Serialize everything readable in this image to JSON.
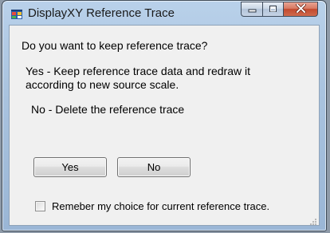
{
  "window": {
    "title": "DisplayXY Reference Trace"
  },
  "dialog": {
    "question": "Do you want to keep reference trace?",
    "yes_description_line1": "Yes - Keep reference trace data and redraw it",
    "yes_description_line2": "according to new source scale.",
    "no_description": "No - Delete the reference trace",
    "yes_button": "Yes",
    "no_button": "No",
    "remember_checkbox_label": "Remeber my choice for current reference trace.",
    "remember_checked": false
  },
  "icons": {
    "app": "app-window-icon",
    "minimize": "minimize-icon",
    "maximize": "maximize-icon",
    "close": "close-icon"
  },
  "colors": {
    "close_button": "#c2492e",
    "title_bar": "#b9d1ea",
    "client_bg": "#f0f0f0"
  }
}
